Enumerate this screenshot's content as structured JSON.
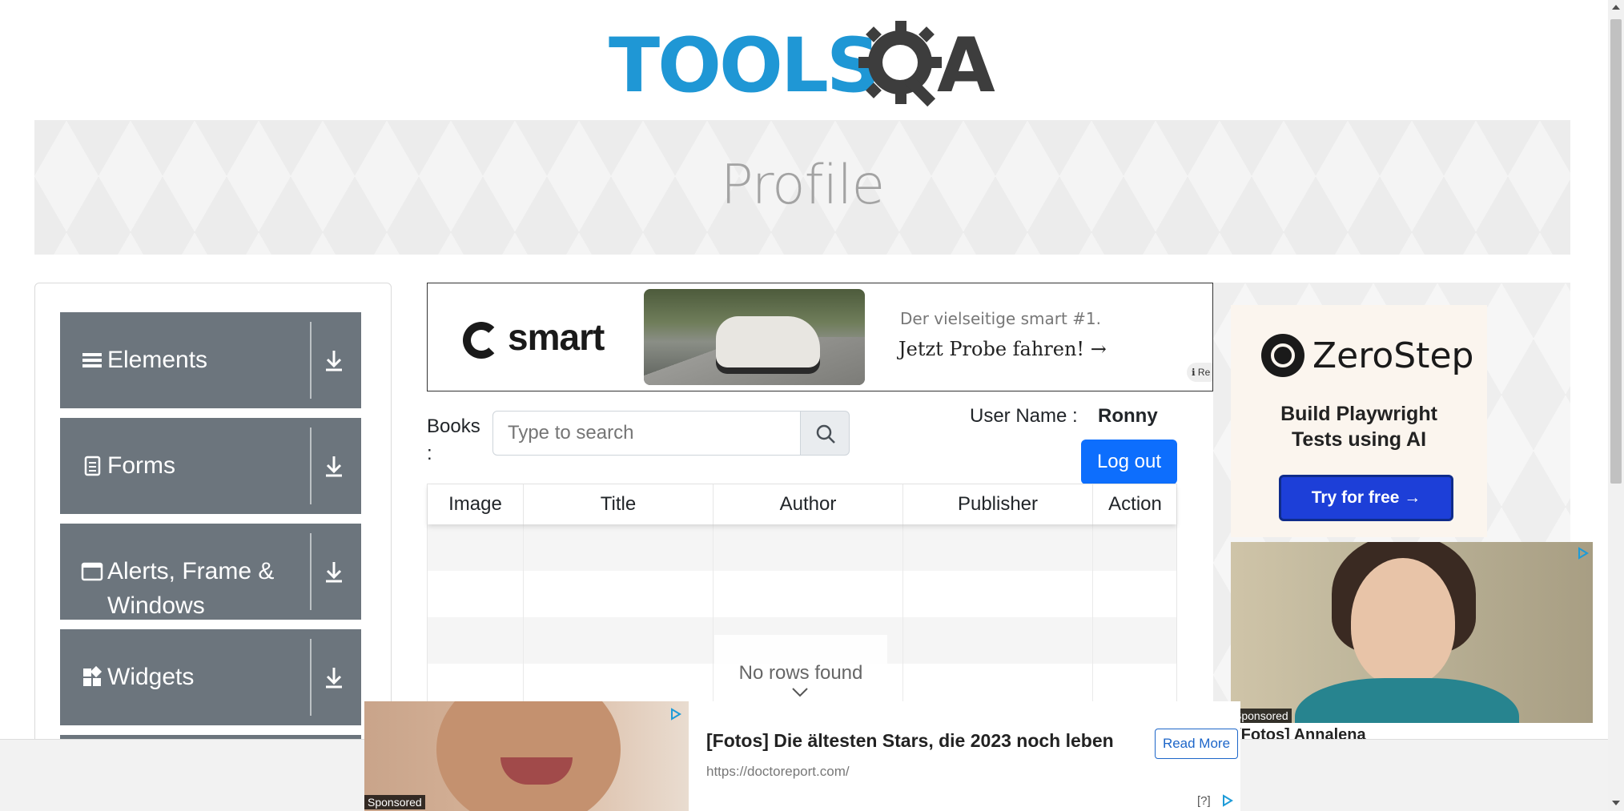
{
  "header": {
    "logo_text": "TOOLS",
    "logo_suffix": "A"
  },
  "banner": {
    "title": "Profile"
  },
  "sidebar": {
    "groups": [
      {
        "label": "Elements",
        "icon": "hamburger-icon"
      },
      {
        "label": "Forms",
        "icon": "document-icon"
      },
      {
        "label": "Alerts, Frame &",
        "label2": "Windows",
        "icon": "window-icon"
      },
      {
        "label": "Widgets",
        "icon": "widgets-icon"
      }
    ]
  },
  "ad_top": {
    "brand": "smart",
    "tagline1": "Der vielseitige smart #1.",
    "tagline2": "Jetzt Probe fahren! →",
    "info": "Re"
  },
  "books": {
    "label_line1": "Books",
    "label_line2": ":",
    "search_placeholder": "Type to search"
  },
  "user": {
    "label": "User Name :",
    "value": "Ronny",
    "logout_label": "Log out"
  },
  "table": {
    "columns": [
      "Image",
      "Title",
      "Author",
      "Publisher",
      "Action"
    ],
    "empty_text": "No rows found"
  },
  "ad_right": {
    "brand": "ZeroStep",
    "tagline_line1": "Build Playwright",
    "tagline_line2": "Tests using AI",
    "cta": "Try for free →",
    "sponsored": "Sponsored",
    "headline": "[Fotos] Annalena"
  },
  "ad_bottom": {
    "title": "[Fotos] Die ältesten Stars, die 2023 noch leben",
    "url": "https://doctoreport.com/",
    "read_more": "Read More",
    "sponsored": "Sponsored",
    "question": "[?]"
  },
  "colors": {
    "logo_blue": "#1f97d5",
    "sidebar_group": "#6c757d",
    "primary_button": "#0d6efd",
    "zerostep_button": "#1d3fd8"
  }
}
